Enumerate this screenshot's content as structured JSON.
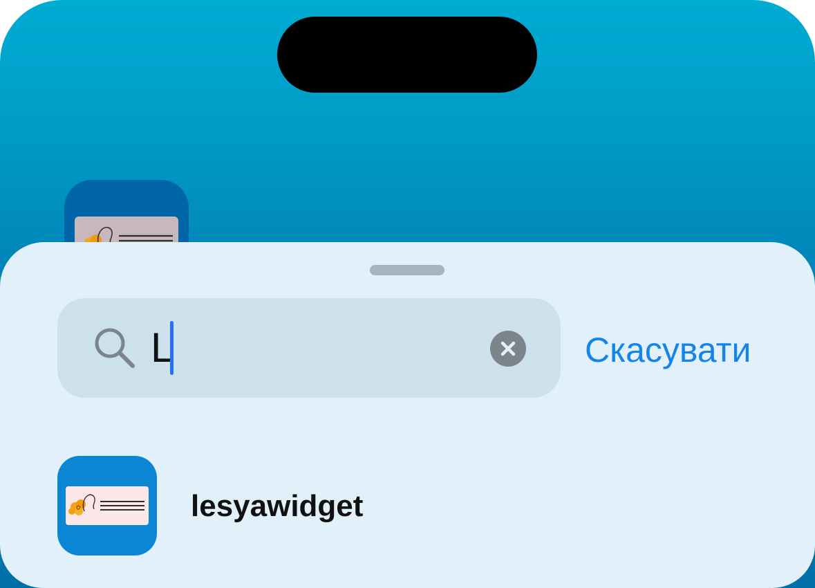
{
  "search": {
    "query": "L",
    "cancel_label": "Скасувати"
  },
  "results": [
    {
      "label": "lesyawidget",
      "icon": "lesyawidget-app-icon"
    }
  ],
  "colors": {
    "wallpaper_top": "#00acd3",
    "wallpaper_bottom": "#006fa8",
    "sheet_background": "#e2f1f9",
    "search_field": "#cde1ec",
    "accent": "#1483ea",
    "caret": "#2a6ef5"
  }
}
